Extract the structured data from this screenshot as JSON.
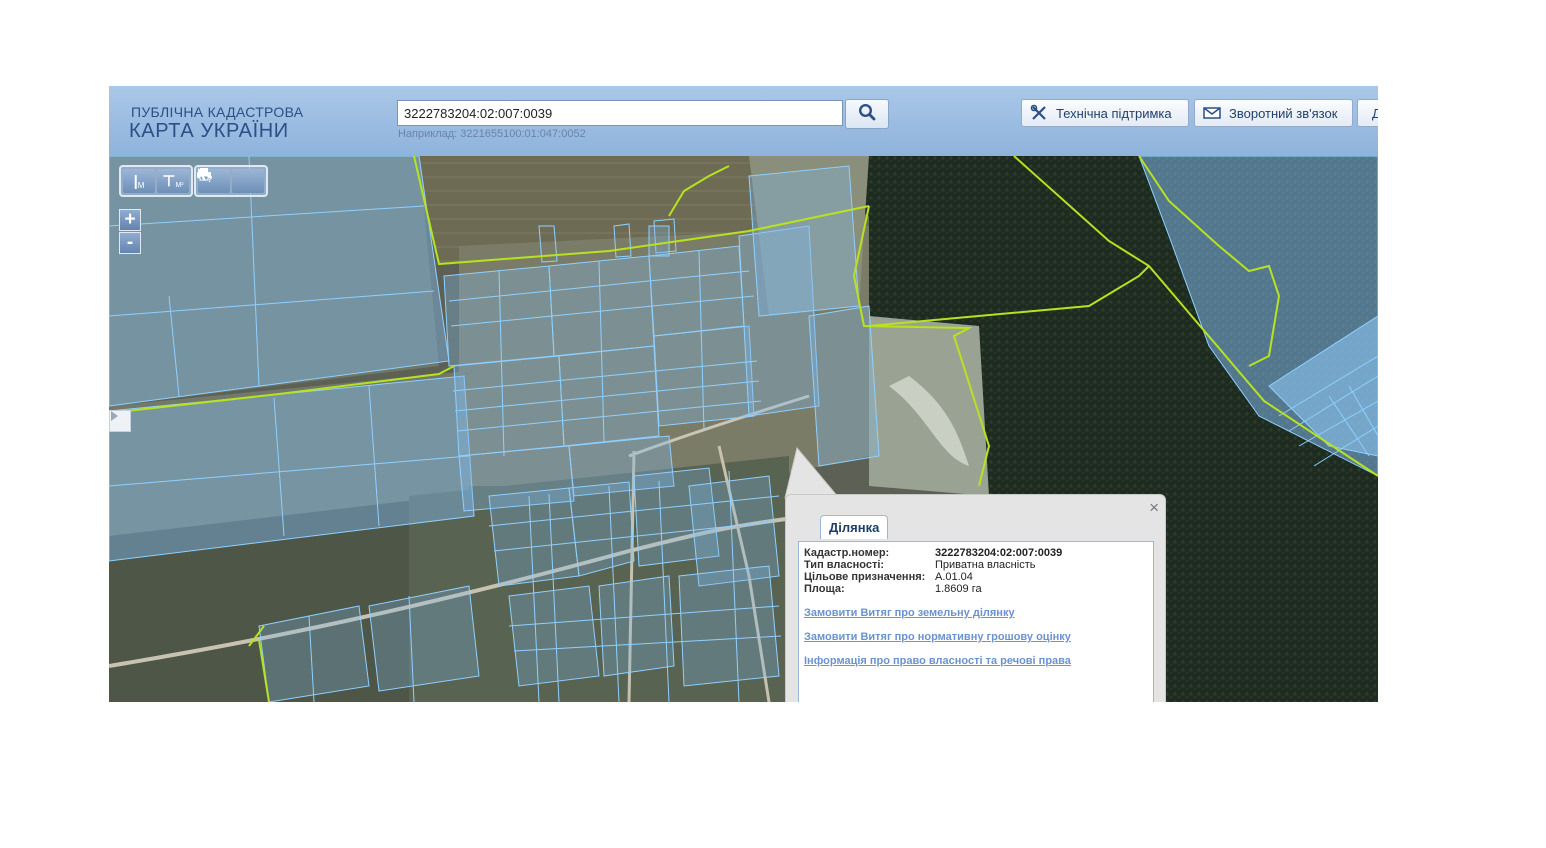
{
  "header": {
    "logo_line1": "ПУБЛІЧНА КАДАСТРОВА",
    "logo_line2": "КАРТА УКРАЇНИ",
    "search_value": "3222783204:02:007:0039",
    "search_hint": "Наприклад: 3221655100:01:047:0052",
    "support_label": "Технічна підтримка",
    "feedback_label": "Зворотний зв'язок",
    "cut_label": "Д"
  },
  "toolbar": {
    "measure_label": "М",
    "measure_area_label": "М²"
  },
  "zoom": {
    "plus": "+",
    "minus": "-"
  },
  "popup": {
    "tab_label": "Ділянка",
    "close_label": "×",
    "fields": [
      {
        "key": "Кадастр.номер:",
        "value": "3222783204:02:007:0039"
      },
      {
        "key": "Тип власності:",
        "value": "Приватна власність"
      },
      {
        "key": "Цільове призначення:",
        "value": "А.01.04"
      },
      {
        "key": "Площа:",
        "value": "1.8609 га"
      }
    ],
    "links": [
      "Замовити Витяг про земельну ділянку",
      "Замовити Витяг про нормативну грошову оцінку",
      "Інформація про право власності та речові права"
    ]
  },
  "colors": {
    "header_bg": "#9dbde3",
    "parcel_fill": "#7fb6e8",
    "parcel_stroke": "#8fd0ff",
    "boundary": "#b7e21f",
    "forest": "#1c2a1d",
    "field": "#6b6a52",
    "link": "#6a93cf"
  },
  "icons": {
    "search": "search-icon",
    "support": "tools-icon",
    "feedback": "envelope-icon"
  }
}
